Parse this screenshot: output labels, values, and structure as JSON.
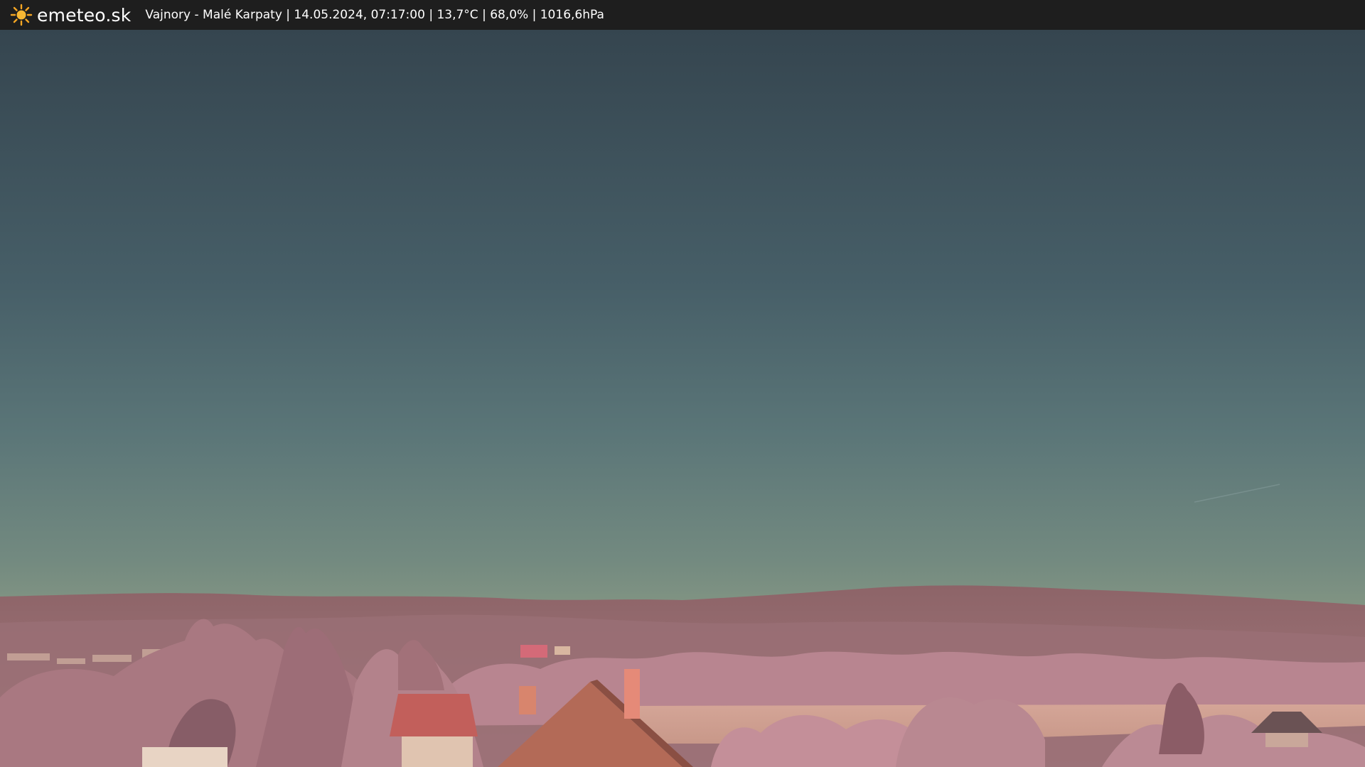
{
  "header": {
    "logo_text": "emeteo.sk",
    "info": "Vajnory - Malé Karpaty | 14.05.2024, 07:17:00 | 13,7°C | 68,0% | 1016,6hPa"
  },
  "icons": {
    "logo": "sun-icon"
  },
  "colors": {
    "bar_background": "#1e1e1e",
    "sun": "#f5a623",
    "sky_top": "#35454f",
    "sky_bottom": "#8a9a84",
    "vegetation": "#b07f8a"
  }
}
